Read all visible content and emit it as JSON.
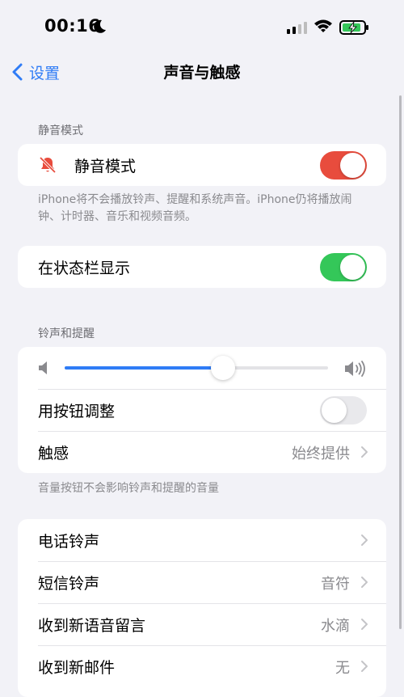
{
  "status_bar": {
    "time": "00:16"
  },
  "nav": {
    "back_label": "设置",
    "title": "声音与触感"
  },
  "silent": {
    "header": "静音模式",
    "label": "静音模式",
    "on": true,
    "toggle_color": "#e84c3d",
    "footer": "iPhone将不会播放铃声、提醒和系统声音。iPhone仍将播放闹钟、计时器、音乐和视频音频。"
  },
  "status_show": {
    "label": "在状态栏显示",
    "on": true,
    "toggle_color": "#34c759"
  },
  "ringer": {
    "header": "铃声和提醒",
    "volume_level": 0.6,
    "adjust_label": "用按钮调整",
    "adjust_on": false,
    "haptics_label": "触感",
    "haptics_value": "始终提供",
    "footer": "音量按钮不会影响铃声和提醒的音量"
  },
  "sounds": [
    {
      "label": "电话铃声",
      "value": ""
    },
    {
      "label": "短信铃声",
      "value": "音符"
    },
    {
      "label": "收到新语音留言",
      "value": "水滴"
    },
    {
      "label": "收到新邮件",
      "value": "无"
    }
  ],
  "colors": {
    "accent": "#2f7cf6",
    "background": "#f2f2f7"
  }
}
